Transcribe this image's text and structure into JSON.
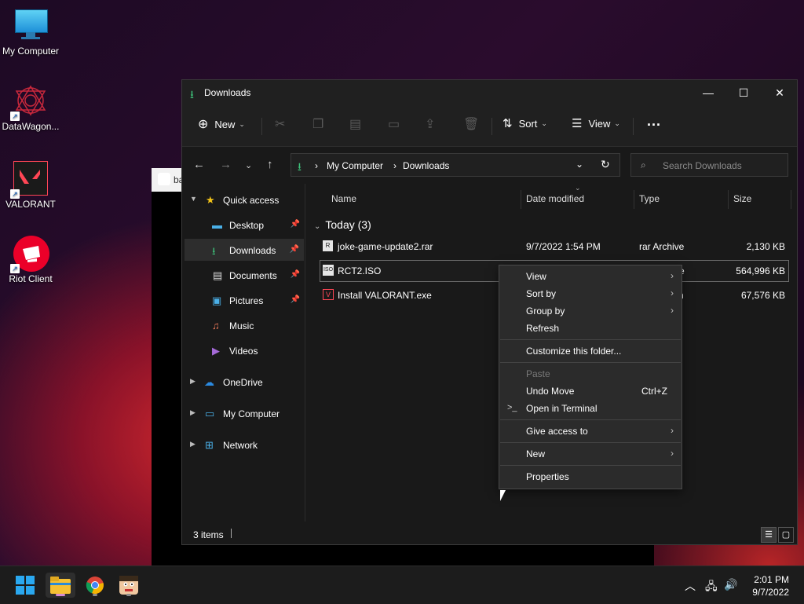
{
  "desktop": {
    "icons": [
      {
        "label": "My Computer"
      },
      {
        "label": "DataWagon..."
      },
      {
        "label": "VALORANT"
      },
      {
        "label": "Riot Client"
      }
    ]
  },
  "background_window": {
    "title": "ba"
  },
  "window": {
    "title": "Downloads",
    "toolbar": {
      "new_label": "New",
      "sort_label": "Sort",
      "view_label": "View",
      "more_label": "..."
    },
    "address": {
      "crumbs": [
        "My Computer",
        "Downloads"
      ]
    },
    "search": {
      "placeholder": "Search Downloads"
    },
    "nav": {
      "quick_access": "Quick access",
      "items": [
        {
          "label": "Desktop"
        },
        {
          "label": "Downloads"
        },
        {
          "label": "Documents"
        },
        {
          "label": "Pictures"
        },
        {
          "label": "Music"
        },
        {
          "label": "Videos"
        }
      ],
      "onedrive": "OneDrive",
      "my_computer": "My Computer",
      "network": "Network"
    },
    "columns": {
      "name": "Name",
      "date": "Date modified",
      "type": "Type",
      "size": "Size"
    },
    "group": "Today (3)",
    "files": [
      {
        "name": "joke-game-update2.rar",
        "date": "9/7/2022 1:54 PM",
        "type": "rar Archive",
        "size": "2,130 KB"
      },
      {
        "name": "RCT2.ISO",
        "date": "",
        "type": "e",
        "size": "564,996 KB"
      },
      {
        "name": "Install VALORANT.exe",
        "date": "",
        "type": "n",
        "size": "67,576 KB"
      }
    ],
    "status": "3 items"
  },
  "context_menu": {
    "view": "View",
    "sort_by": "Sort by",
    "group_by": "Group by",
    "refresh": "Refresh",
    "customize": "Customize this folder...",
    "paste": "Paste",
    "undo_move": "Undo Move",
    "undo_shortcut": "Ctrl+Z",
    "open_terminal": "Open in Terminal",
    "give_access": "Give access to",
    "new": "New",
    "properties": "Properties"
  },
  "taskbar": {
    "time": "2:01 PM",
    "date": "9/7/2022"
  },
  "colors": {
    "accent_green": "#3ec27a",
    "bg": "#191919"
  }
}
